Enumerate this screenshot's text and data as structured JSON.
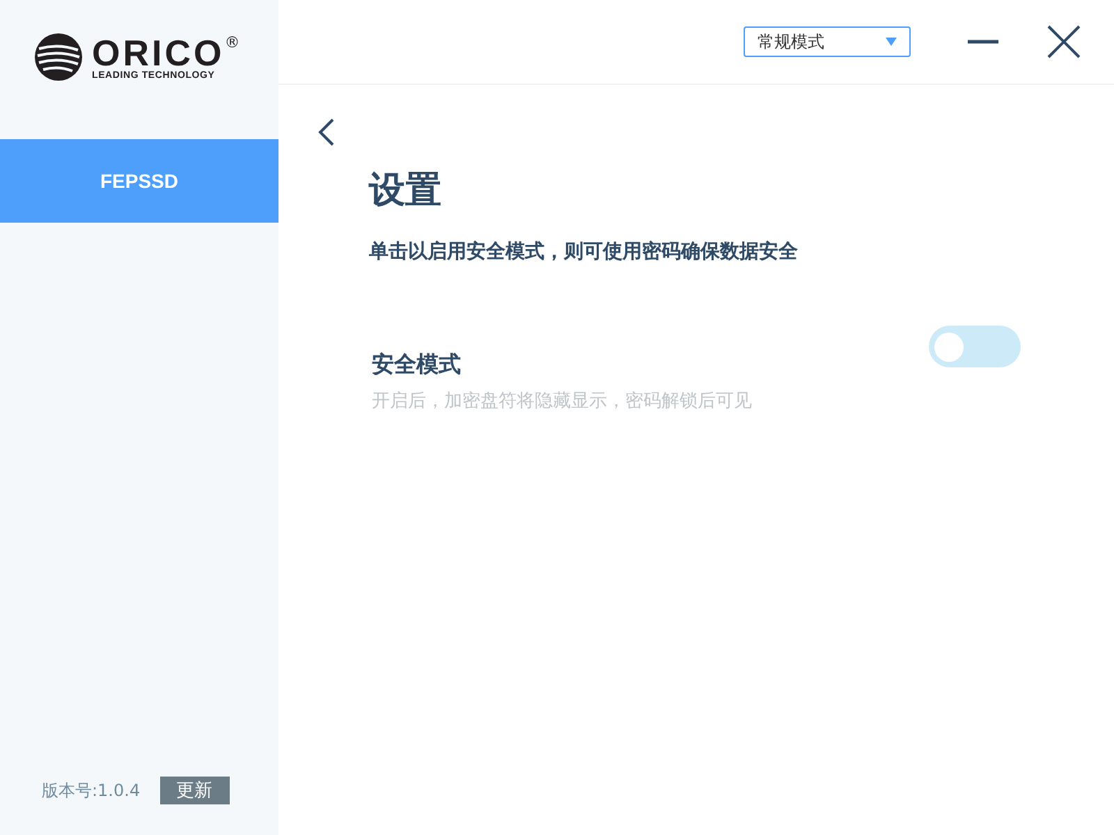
{
  "logo": {
    "brand": "ORICO",
    "registered": "®",
    "tagline": "LEADING TECHNOLOGY"
  },
  "sidebar": {
    "items": [
      {
        "label": "FEPSSD",
        "selected": true
      }
    ]
  },
  "footer": {
    "version": "版本号:1.0.4",
    "update_button": "更新"
  },
  "toolbar": {
    "mode_dropdown": {
      "value": "常规模式"
    }
  },
  "settings": {
    "title": "设置",
    "description": "单击以启用安全模式，则可使用密码确保数据安全",
    "options": [
      {
        "label": "安全模式",
        "hint": "开启后，加密盘符将隐藏显示，密码解锁后可见",
        "on": false
      }
    ]
  }
}
